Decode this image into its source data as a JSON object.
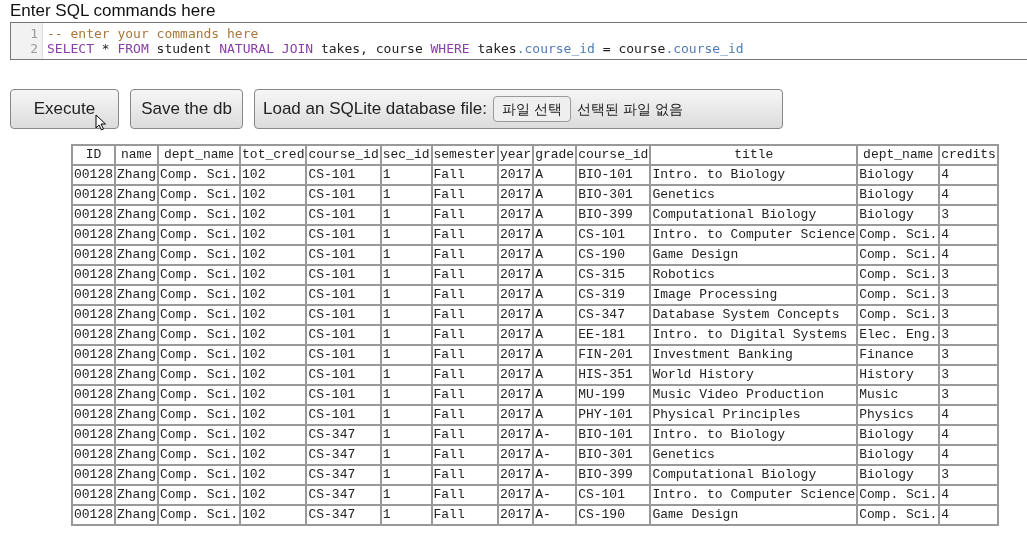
{
  "editor": {
    "label": "Enter SQL commands here",
    "lines": [
      {
        "number": "1",
        "tokens": [
          {
            "kind": "comment",
            "text": "-- enter your commands here"
          }
        ]
      },
      {
        "number": "2",
        "tokens": [
          {
            "kind": "keyword",
            "text": "SELECT"
          },
          {
            "kind": "plain",
            "text": " * "
          },
          {
            "kind": "keyword",
            "text": "FROM"
          },
          {
            "kind": "plain",
            "text": " student "
          },
          {
            "kind": "keyword",
            "text": "NATURAL JOIN"
          },
          {
            "kind": "plain",
            "text": " takes, course "
          },
          {
            "kind": "keyword",
            "text": "WHERE"
          },
          {
            "kind": "plain",
            "text": " takes"
          },
          {
            "kind": "property",
            "text": ".course_id"
          },
          {
            "kind": "plain",
            "text": " = course"
          },
          {
            "kind": "property",
            "text": ".course_id"
          }
        ]
      }
    ]
  },
  "buttons": {
    "execute": "Execute",
    "save": "Save the db",
    "load_label": "Load an SQLite database file:",
    "file_button": "파일 선택",
    "file_status": "선택된 파일 없음"
  },
  "table": {
    "columns": [
      "ID",
      "name",
      "dept_name",
      "tot_cred",
      "course_id",
      "sec_id",
      "semester",
      "year",
      "grade",
      "course_id",
      "title",
      "dept_name",
      "credits"
    ],
    "rows": [
      [
        "00128",
        "Zhang",
        "Comp. Sci.",
        "102",
        "CS-101",
        "1",
        "Fall",
        "2017",
        "A",
        "BIO-101",
        "Intro. to Biology",
        "Biology",
        "4"
      ],
      [
        "00128",
        "Zhang",
        "Comp. Sci.",
        "102",
        "CS-101",
        "1",
        "Fall",
        "2017",
        "A",
        "BIO-301",
        "Genetics",
        "Biology",
        "4"
      ],
      [
        "00128",
        "Zhang",
        "Comp. Sci.",
        "102",
        "CS-101",
        "1",
        "Fall",
        "2017",
        "A",
        "BIO-399",
        "Computational Biology",
        "Biology",
        "3"
      ],
      [
        "00128",
        "Zhang",
        "Comp. Sci.",
        "102",
        "CS-101",
        "1",
        "Fall",
        "2017",
        "A",
        "CS-101",
        "Intro. to Computer Science",
        "Comp. Sci.",
        "4"
      ],
      [
        "00128",
        "Zhang",
        "Comp. Sci.",
        "102",
        "CS-101",
        "1",
        "Fall",
        "2017",
        "A",
        "CS-190",
        "Game Design",
        "Comp. Sci.",
        "4"
      ],
      [
        "00128",
        "Zhang",
        "Comp. Sci.",
        "102",
        "CS-101",
        "1",
        "Fall",
        "2017",
        "A",
        "CS-315",
        "Robotics",
        "Comp. Sci.",
        "3"
      ],
      [
        "00128",
        "Zhang",
        "Comp. Sci.",
        "102",
        "CS-101",
        "1",
        "Fall",
        "2017",
        "A",
        "CS-319",
        "Image Processing",
        "Comp. Sci.",
        "3"
      ],
      [
        "00128",
        "Zhang",
        "Comp. Sci.",
        "102",
        "CS-101",
        "1",
        "Fall",
        "2017",
        "A",
        "CS-347",
        "Database System Concepts",
        "Comp. Sci.",
        "3"
      ],
      [
        "00128",
        "Zhang",
        "Comp. Sci.",
        "102",
        "CS-101",
        "1",
        "Fall",
        "2017",
        "A",
        "EE-181",
        "Intro. to Digital Systems",
        "Elec. Eng.",
        "3"
      ],
      [
        "00128",
        "Zhang",
        "Comp. Sci.",
        "102",
        "CS-101",
        "1",
        "Fall",
        "2017",
        "A",
        "FIN-201",
        "Investment Banking",
        "Finance",
        "3"
      ],
      [
        "00128",
        "Zhang",
        "Comp. Sci.",
        "102",
        "CS-101",
        "1",
        "Fall",
        "2017",
        "A",
        "HIS-351",
        "World History",
        "History",
        "3"
      ],
      [
        "00128",
        "Zhang",
        "Comp. Sci.",
        "102",
        "CS-101",
        "1",
        "Fall",
        "2017",
        "A",
        "MU-199",
        "Music Video Production",
        "Music",
        "3"
      ],
      [
        "00128",
        "Zhang",
        "Comp. Sci.",
        "102",
        "CS-101",
        "1",
        "Fall",
        "2017",
        "A",
        "PHY-101",
        "Physical Principles",
        "Physics",
        "4"
      ],
      [
        "00128",
        "Zhang",
        "Comp. Sci.",
        "102",
        "CS-347",
        "1",
        "Fall",
        "2017",
        "A-",
        "BIO-101",
        "Intro. to Biology",
        "Biology",
        "4"
      ],
      [
        "00128",
        "Zhang",
        "Comp. Sci.",
        "102",
        "CS-347",
        "1",
        "Fall",
        "2017",
        "A-",
        "BIO-301",
        "Genetics",
        "Biology",
        "4"
      ],
      [
        "00128",
        "Zhang",
        "Comp. Sci.",
        "102",
        "CS-347",
        "1",
        "Fall",
        "2017",
        "A-",
        "BIO-399",
        "Computational Biology",
        "Biology",
        "3"
      ],
      [
        "00128",
        "Zhang",
        "Comp. Sci.",
        "102",
        "CS-347",
        "1",
        "Fall",
        "2017",
        "A-",
        "CS-101",
        "Intro. to Computer Science",
        "Comp. Sci.",
        "4"
      ],
      [
        "00128",
        "Zhang",
        "Comp. Sci.",
        "102",
        "CS-347",
        "1",
        "Fall",
        "2017",
        "A-",
        "CS-190",
        "Game Design",
        "Comp. Sci.",
        "4"
      ]
    ]
  }
}
